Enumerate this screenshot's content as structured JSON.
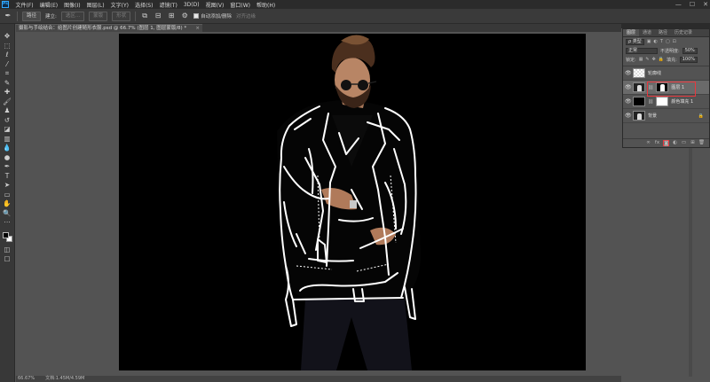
{
  "menu": {
    "logo": "Ps",
    "items": [
      "文件(F)",
      "编辑(E)",
      "图像(I)",
      "图层(L)",
      "文字(Y)",
      "选择(S)",
      "滤镜(T)",
      "3D(D)",
      "视图(V)",
      "窗口(W)",
      "帮助(H)"
    ],
    "min": "—",
    "max": "☐",
    "close": "✕"
  },
  "options": {
    "path_mode": "路径",
    "make_label": "建立:",
    "selection_btn": "选区...",
    "mask_btn": "蒙版",
    "shape_btn": "形状",
    "auto_add_delete": "自动添加/删除",
    "align_edges": "对齐边缘"
  },
  "document": {
    "tab_title": "摄影与手绘结合：给图片创建随形衣服.psd @ 66.7% (图层 1, 图层蒙版/8) *",
    "zoom": "66.67%",
    "doc_info": "文档:1.45M/4.59M"
  },
  "layers_panel": {
    "tabs": [
      "图层",
      "通道",
      "路径",
      "历史记录"
    ],
    "filter_kind": "ρ 类型",
    "blend_mode": "正常",
    "opacity_label": "不透明度:",
    "opacity_value": "50%",
    "lock_label": "锁定:",
    "fill_label": "填充:",
    "fill_value": "100%",
    "layers": [
      {
        "name": "轮廓线",
        "thumb": "checker",
        "mask": "",
        "selected": false
      },
      {
        "name": "图层 1",
        "thumb": "photo",
        "mask": "mask",
        "selected": true
      },
      {
        "name": "颜色填充 1",
        "thumb": "black",
        "mask": "white",
        "selected": false
      },
      {
        "name": "背景",
        "thumb": "photo",
        "mask": "",
        "selected": false
      }
    ],
    "footer_icons": [
      "∞",
      "fx",
      "◙",
      "◐",
      "▭",
      "⊞",
      "🗑"
    ]
  },
  "colors": {
    "highlight": "#e8373d",
    "canvas_bg": "#000000"
  }
}
